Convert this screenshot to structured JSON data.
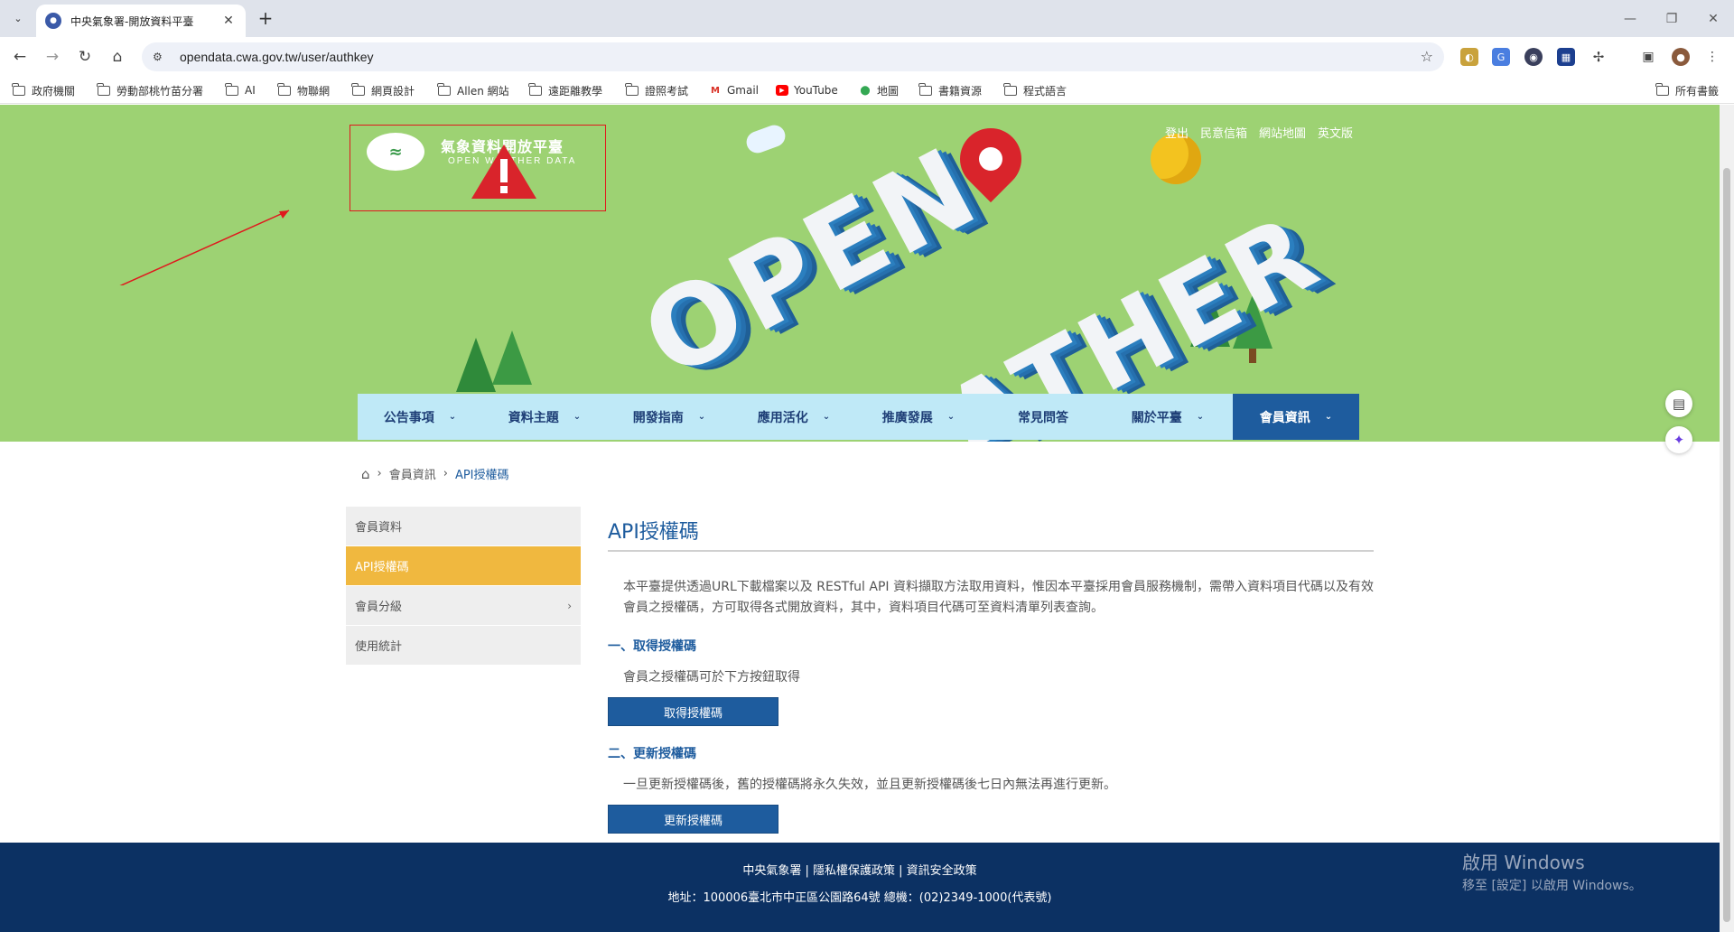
{
  "browser": {
    "tab_title": "中央氣象署-開放資料平臺",
    "url": "opendata.cwa.gov.tw/user/authkey",
    "bookmarks": [
      "政府機關",
      "勞動部桃竹苗分署",
      "AI",
      "物聯網",
      "網頁設計",
      "Allen 網站",
      "遠距離教學",
      "證照考試",
      "Gmail",
      "YouTube",
      "地圖",
      "書籍資源",
      "程式語言"
    ],
    "all_bookmarks": "所有書籤"
  },
  "header": {
    "logo_title": "氣象資料開放平臺",
    "logo_subtitle": "OPEN WEATHER DATA",
    "top_links": [
      "登出",
      "民意信箱",
      "網站地圖",
      "英文版"
    ],
    "hero_word_1": "OPEN",
    "hero_word_2": "ATHER"
  },
  "nav": {
    "items": [
      "公告事項",
      "資料主題",
      "開發指南",
      "應用活化",
      "推廣發展",
      "常見問答",
      "關於平臺"
    ],
    "active": "會員資訊"
  },
  "breadcrumb": {
    "level1": "會員資訊",
    "current": "API授權碼"
  },
  "sidebar": {
    "items": [
      "會員資料",
      "API授權碼",
      "會員分級",
      "使用統計"
    ]
  },
  "content": {
    "title": "API授權碼",
    "intro": "本平臺提供透過URL下載檔案以及 RESTful API 資料擷取方法取用資料，惟因本平臺採用會員服務機制，需帶入資料項目代碼以及有效會員之授權碼，方可取得各式開放資料，其中，資料項目代碼可至資料清單列表查詢。",
    "section1_title": "一、取得授權碼",
    "section1_text": "會員之授權碼可於下方按鈕取得",
    "section1_button": "取得授權碼",
    "section2_title": "二、更新授權碼",
    "section2_text": "一旦更新授權碼後，舊的授權碼將永久失效，並且更新授權碼後七日內無法再進行更新。",
    "section2_button": "更新授權碼"
  },
  "footer": {
    "links": "中央氣象署 | 隱私權保護政策 | 資訊安全政策",
    "address": "地址：100006臺北市中正區公園路64號 總機：(02)2349-1000(代表號)",
    "activate_title": "啟用 Windows",
    "activate_sub": "移至 [設定] 以啟用 Windows。"
  },
  "colors": {
    "nav_bg": "#bfe9f7",
    "active_nav": "#1e5c9e",
    "sidebar_active": "#f0b83f",
    "footer_bg": "#0c3163",
    "hero_bg": "#9dd273"
  }
}
